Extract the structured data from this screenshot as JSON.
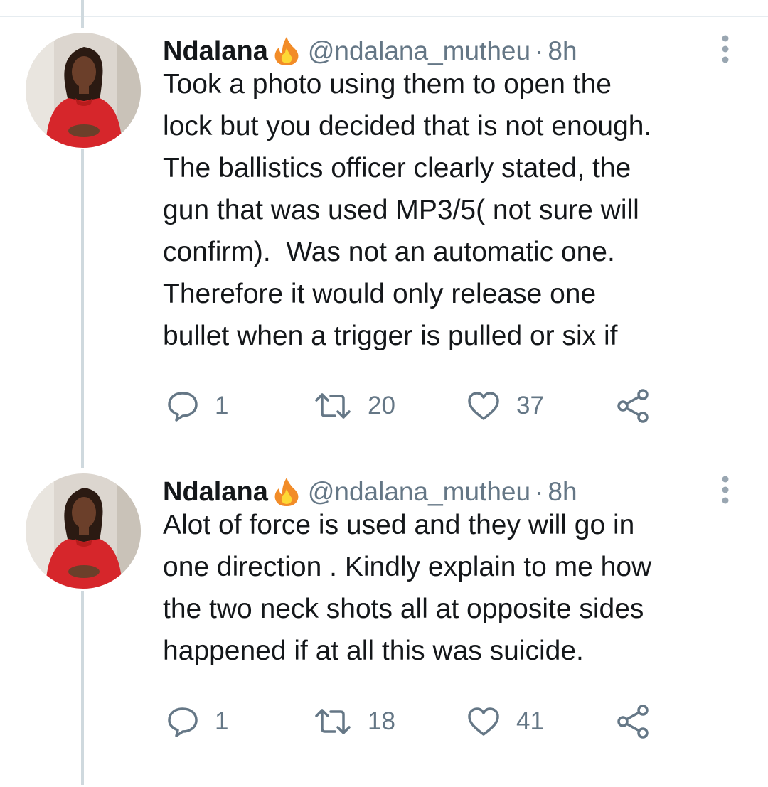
{
  "colors": {
    "thread_line": "#cfd9de",
    "secondary_text": "#657786",
    "primary_text": "#14171a",
    "avatar_dress": "#d6262b",
    "fire_outer": "#f28c28",
    "fire_inner": "#fdd835"
  },
  "tweets": [
    {
      "author": {
        "name": "Ndalana",
        "emoji_icon": "fire-icon",
        "handle": "@ndalana_mutheu",
        "separator": "·",
        "time": "8h"
      },
      "text": "Took a photo using them to open the\nlock but you decided that is not enough.\nThe ballistics officer clearly stated, the\ngun that was used MP3/5( not sure will\nconfirm).  Was not an automatic one.\nTherefore it would only release one\nbullet when a trigger is pulled or six if",
      "actions": {
        "replies": "1",
        "retweets": "20",
        "likes": "37"
      }
    },
    {
      "author": {
        "name": "Ndalana",
        "emoji_icon": "fire-icon",
        "handle": "@ndalana_mutheu",
        "separator": "·",
        "time": "8h"
      },
      "text": "Alot of force is used and they will go in\none direction . Kindly explain to me how\nthe two neck shots all at opposite sides\nhappened if at all this was suicide.",
      "actions": {
        "replies": "1",
        "retweets": "18",
        "likes": "41"
      }
    }
  ]
}
